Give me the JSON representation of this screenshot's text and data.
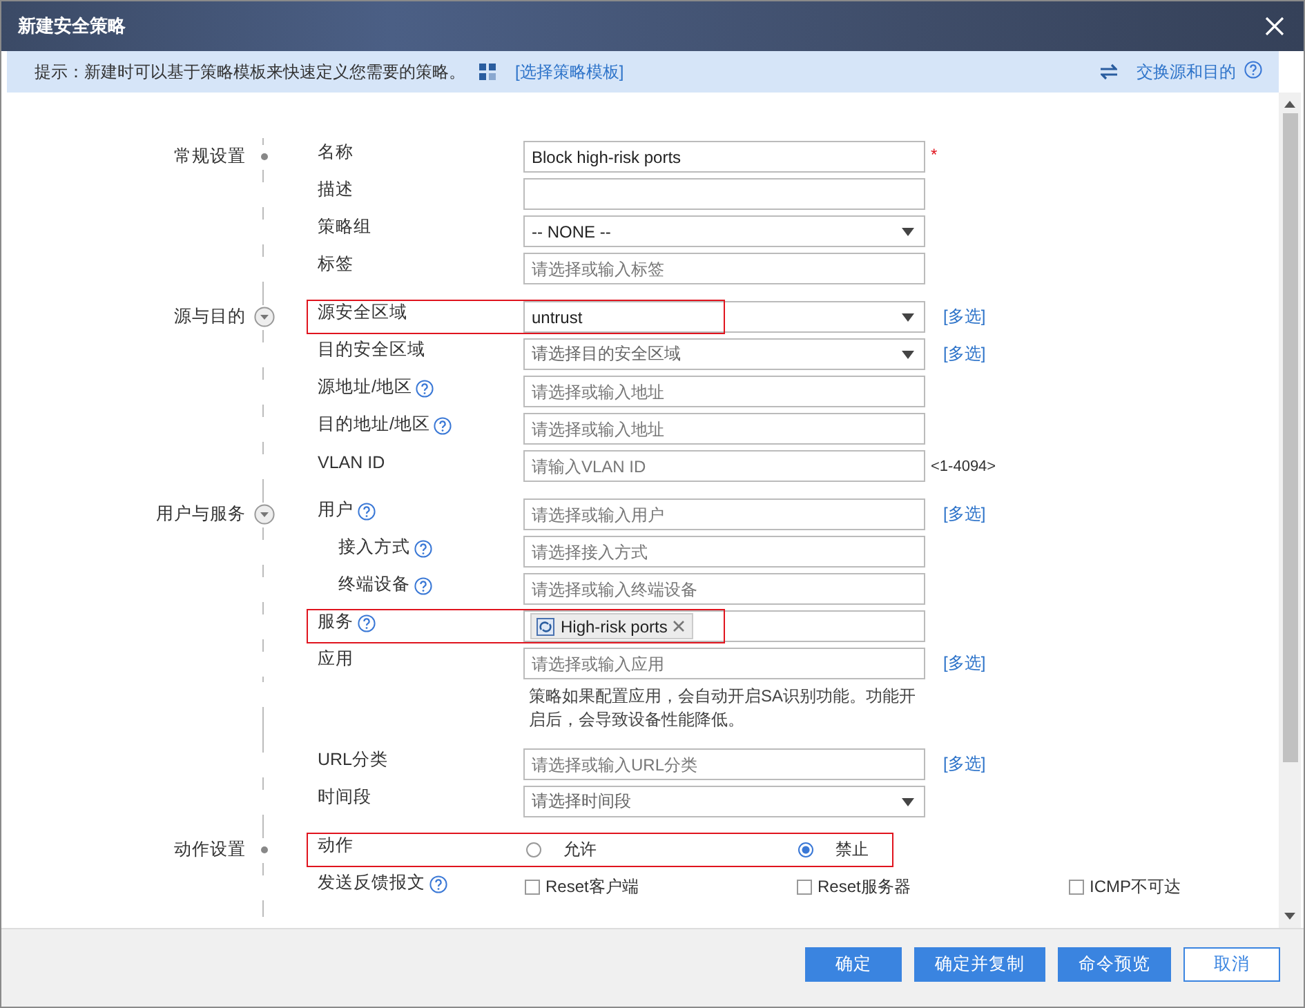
{
  "window": {
    "title": "新建安全策略"
  },
  "hint": {
    "text": "提示：新建时可以基于策略模板来快速定义您需要的策略。",
    "link": "[选择策略模板]",
    "action": "交换源和目的"
  },
  "sections": [
    {
      "label": "常规设置",
      "kind": "dot",
      "rows": [
        {
          "kind": "input",
          "label": "名称",
          "value": "Block high-risk ports",
          "required_mark": "*"
        },
        {
          "kind": "input",
          "label": "描述"
        },
        {
          "kind": "select",
          "label": "策略组",
          "value": "-- NONE --"
        },
        {
          "kind": "input",
          "label": "标签",
          "placeholder": "请选择或输入标签"
        }
      ]
    },
    {
      "label": "源与目的",
      "kind": "toggle",
      "rows": [
        {
          "kind": "select",
          "label": "源安全区域",
          "value": "untrust",
          "link": "[多选]",
          "highlighted": true
        },
        {
          "kind": "select",
          "label": "目的安全区域",
          "placeholder": "请选择目的安全区域",
          "link": "[多选]"
        },
        {
          "kind": "input",
          "label": "源地址/地区",
          "help": true,
          "placeholder": "请选择或输入地址"
        },
        {
          "kind": "input",
          "label": "目的地址/地区",
          "help": true,
          "placeholder": "请选择或输入地址"
        },
        {
          "kind": "input",
          "label": "VLAN ID",
          "placeholder": "请输入VLAN ID",
          "suffix": "<1-4094>"
        }
      ]
    },
    {
      "label": "用户与服务",
      "kind": "toggle",
      "rows": [
        {
          "kind": "input",
          "label": "用户",
          "help": true,
          "placeholder": "请选择或输入用户",
          "link": "[多选]"
        },
        {
          "kind": "input",
          "label": "接入方式",
          "help": true,
          "indent": true,
          "placeholder": "请选择接入方式"
        },
        {
          "kind": "input",
          "label": "终端设备",
          "help": true,
          "indent": true,
          "placeholder": "请选择或输入终端设备"
        },
        {
          "kind": "tags",
          "label": "服务",
          "help": true,
          "tags": [
            "High-risk ports"
          ],
          "highlighted": true
        },
        {
          "kind": "input",
          "label": "应用",
          "placeholder": "请选择或输入应用",
          "link": "[多选]"
        },
        {
          "kind": "note",
          "text": "策略如果配置应用，会自动开启SA识别功能。功能开启后，会导致设备性能降低。"
        },
        {
          "kind": "input",
          "label": "URL分类",
          "placeholder": "请选择或输入URL分类",
          "link": "[多选]"
        },
        {
          "kind": "select",
          "label": "时间段",
          "placeholder": "请选择时间段"
        }
      ]
    },
    {
      "label": "动作设置",
      "kind": "dot",
      "rows": [
        {
          "kind": "radio",
          "label": "动作",
          "highlighted": true,
          "options": [
            {
              "label": "允许",
              "selected": false
            },
            {
              "label": "禁止",
              "selected": true
            }
          ]
        },
        {
          "kind": "checkbox",
          "label": "发送反馈报文",
          "help": true,
          "options": [
            {
              "label": "Reset客户端",
              "checked": false
            },
            {
              "label": "Reset服务器",
              "checked": false
            },
            {
              "label": "ICMP不可达",
              "checked": false
            }
          ]
        }
      ]
    }
  ],
  "buttons": [
    {
      "label": "确定",
      "kind": "primary"
    },
    {
      "label": "确定并复制",
      "kind": "primary"
    },
    {
      "label": "命令预览",
      "kind": "primary"
    },
    {
      "label": "取消",
      "kind": "secondary"
    }
  ]
}
